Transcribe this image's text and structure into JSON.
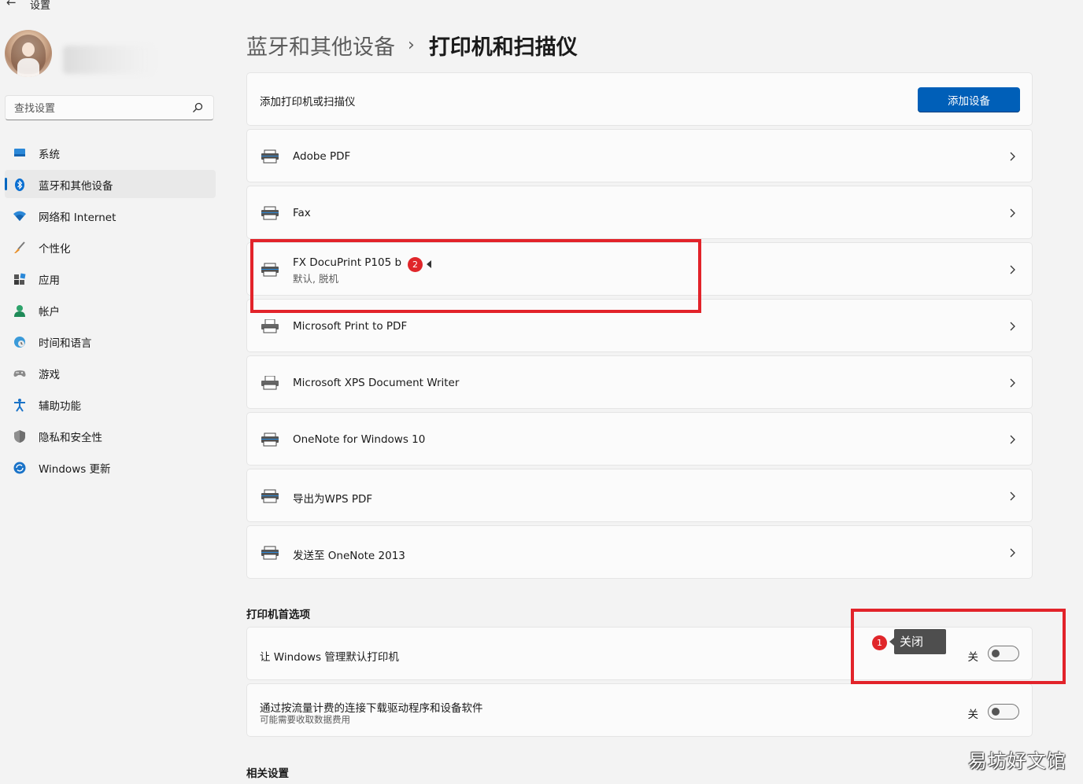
{
  "app": {
    "title": "设置"
  },
  "search": {
    "placeholder": "查找设置"
  },
  "sidebar": {
    "items": [
      {
        "label": "系统",
        "icon": "monitor-icon"
      },
      {
        "label": "蓝牙和其他设备",
        "icon": "bluetooth-icon",
        "active": true
      },
      {
        "label": "网络和 Internet",
        "icon": "wifi-icon"
      },
      {
        "label": "个性化",
        "icon": "brush-icon"
      },
      {
        "label": "应用",
        "icon": "apps-icon"
      },
      {
        "label": "帐户",
        "icon": "person-icon"
      },
      {
        "label": "时间和语言",
        "icon": "globe-clock-icon"
      },
      {
        "label": "游戏",
        "icon": "gamepad-icon"
      },
      {
        "label": "辅助功能",
        "icon": "accessibility-icon"
      },
      {
        "label": "隐私和安全性",
        "icon": "shield-icon"
      },
      {
        "label": "Windows 更新",
        "icon": "update-icon"
      }
    ]
  },
  "breadcrumb": {
    "parent": "蓝牙和其他设备",
    "separator": "›",
    "current": "打印机和扫描仪"
  },
  "add_card": {
    "label": "添加打印机或扫描仪",
    "button": "添加设备"
  },
  "printers": [
    {
      "name": "Adobe PDF",
      "status": ""
    },
    {
      "name": "Fax",
      "status": ""
    },
    {
      "name": "FX DocuPrint P105 b",
      "status": "默认, 脱机"
    },
    {
      "name": "Microsoft Print to PDF",
      "status": ""
    },
    {
      "name": "Microsoft XPS Document Writer",
      "status": ""
    },
    {
      "name": "OneNote for Windows 10",
      "status": ""
    },
    {
      "name": "导出为WPS PDF",
      "status": ""
    },
    {
      "name": "发送至 OneNote 2013",
      "status": ""
    }
  ],
  "preferences": {
    "title": "打印机首选项",
    "items": [
      {
        "label": "让 Windows 管理默认打印机",
        "state": "关",
        "on": false
      },
      {
        "label": "通过按流量计费的连接下载驱动程序和设备软件",
        "description": "可能需要收取数据费用",
        "state": "关",
        "on": false
      }
    ]
  },
  "related": {
    "title": "相关设置"
  },
  "annotations": {
    "badge1": "1",
    "badge2": "2",
    "tooltip": "关闭",
    "color": "#e2232a"
  },
  "watermark": "易坊好文馆",
  "colors": {
    "accent": "#005fb8",
    "background": "#f3f3f3",
    "card": "#fbfbfb"
  }
}
